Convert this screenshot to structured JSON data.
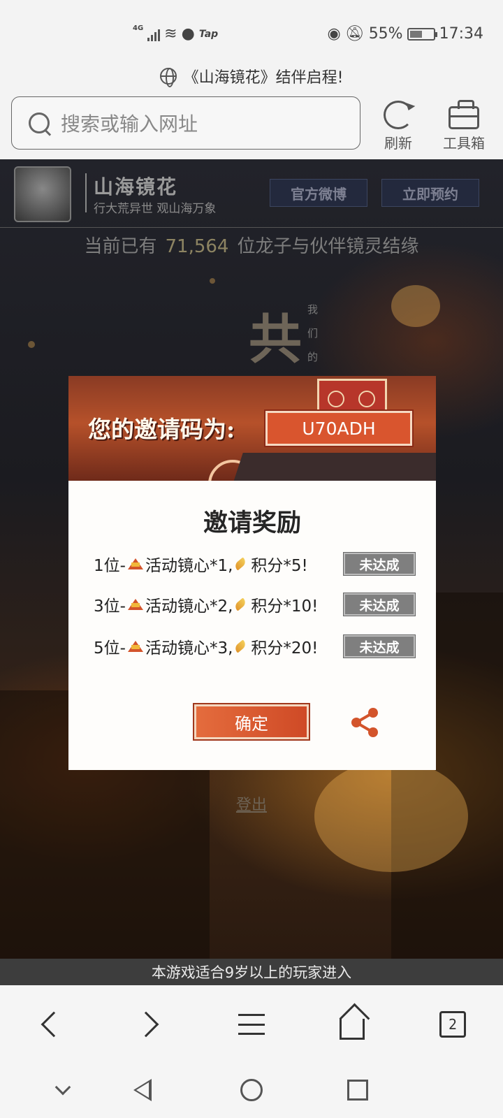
{
  "status_bar": {
    "network": "4G",
    "tap_label": "Tap",
    "battery": "55%",
    "battery_level": 0.55,
    "time": "17:34"
  },
  "page_title": "《山海镜花》结伴启程!",
  "address_bar": {
    "placeholder": "搜索或输入网址",
    "refresh_label": "刷新",
    "toolbox_label": "工具箱"
  },
  "game_header": {
    "name": "山海镜花",
    "slogan": "行大荒异世 观山海万象",
    "weibo_button": "官方微博",
    "reserve_button": "立即预约"
  },
  "counter": {
    "prefix": "当前已有",
    "count": "71,564",
    "suffix": "位龙子与伙伴镜灵结缘"
  },
  "background_text": {
    "big_char": "共",
    "vertical": [
      "我",
      "们",
      "的"
    ]
  },
  "modal": {
    "invite_label": "您的邀请码为:",
    "invite_code": "U70ADH",
    "title": "邀请奖励",
    "rewards": [
      {
        "rank": "1位-",
        "mirror": "活动镜心*1,",
        "points": "积分*5!",
        "status": "未达成"
      },
      {
        "rank": "3位-",
        "mirror": "活动镜心*2,",
        "points": "积分*10!",
        "status": "未达成"
      },
      {
        "rank": "5位-",
        "mirror": "活动镜心*3,",
        "points": "积分*20!",
        "status": "未达成"
      }
    ],
    "confirm_button": "确定"
  },
  "logout_link": "登出",
  "age_banner": "本游戏适合9岁以上的玩家进入",
  "browser_nav": {
    "tab_count": "2"
  },
  "colors": {
    "accent": "#d9552e",
    "status_grey": "#7f7f7f",
    "modal_bg": "#fefdfb"
  }
}
